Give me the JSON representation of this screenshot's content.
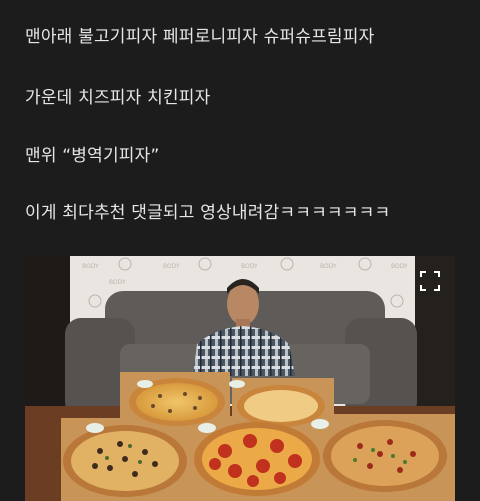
{
  "post": {
    "lines": [
      "맨아래 불고기피자 페퍼로니피자 슈퍼슈프림피자",
      "가운데  치즈피자  치킨피자",
      "맨위  “병역기피자”",
      "이게 최다추천 댓글되고 영상내려감ㅋㅋㅋㅋㅋㅋㅋ"
    ]
  },
  "photo": {
    "backdrop_text": [
      "BODY",
      "BODY",
      "BODY",
      "BODY",
      "BODY",
      "BODY"
    ],
    "expand_icon": "expand-icon"
  }
}
